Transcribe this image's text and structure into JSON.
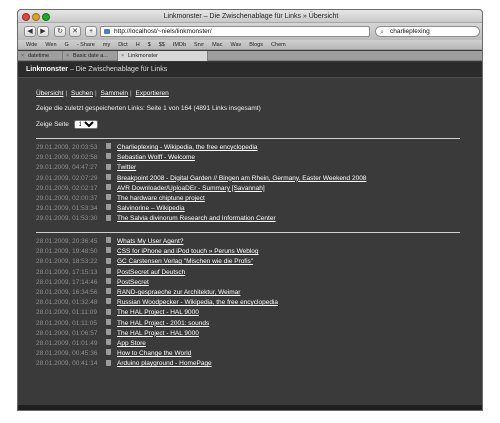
{
  "window": {
    "title": "Linkmonster – Die Zwischenablage für Links » Übersicht"
  },
  "toolbar": {
    "back": "◀",
    "forward": "▶",
    "reload": "↻",
    "stop": "✕",
    "add": "+",
    "url": "http://localhost/~niels/linkmonster/",
    "search_value": "charlieplexing"
  },
  "bookmarks": [
    "Wde",
    "Wen",
    "G",
    "- Share",
    "my",
    "Dict",
    "H",
    "$",
    "$$",
    "IMDb",
    "Srvr",
    "Mac",
    "Wav",
    "Blogs",
    "Chem"
  ],
  "tabs": [
    {
      "label": "datetime",
      "active": false
    },
    {
      "label": "Basic date a...",
      "active": false
    },
    {
      "label": "Linkmonster",
      "active": true
    }
  ],
  "header": {
    "brand": "Linkmonster",
    "tagline": " – Die Zwischenablage für Links"
  },
  "nav": {
    "items": [
      "Übersicht",
      "Suchen",
      "Sammeln",
      "Exportieren"
    ]
  },
  "info": "Zeige die zuletzt gespeicherten Links: Seite 1 von 164 (4891 Links insgesamt)",
  "page_select": {
    "label": "Zeige Seite",
    "value": "1"
  },
  "groups": [
    [
      {
        "ts": "29.01.2009, 20:03:53",
        "title": "Charlieplexing - Wikipedia, the free encyclopedia"
      },
      {
        "ts": "29.01.2009, 09:02:58",
        "title": "Sebastian Wolff - Welcome"
      },
      {
        "ts": "29.01.2009, 04:47:27",
        "title": "Twitter"
      },
      {
        "ts": "29.01.2009, 02:07:29",
        "title": "Breakpoint 2008 - Digital Garden // Bingen am Rhein, Germany, Easter Weekend 2008"
      },
      {
        "ts": "29.01.2009, 02:02:17",
        "title": "AVR Downloader/UploaDEr - Summary [Savannah]"
      },
      {
        "ts": "29.01.2009, 02:00:37",
        "title": "The hardware chiptune project"
      },
      {
        "ts": "29.01.2009, 01:53:34",
        "title": "Salvinorine – Wikipedia"
      },
      {
        "ts": "29.01.2009, 01:53:30",
        "title": "The Salvia divinorum Research and Information Center"
      }
    ],
    [
      {
        "ts": "28.01.2009, 20:36:45",
        "title": "Whats My User Agent?"
      },
      {
        "ts": "28.01.2009, 19:48:50",
        "title": "CSS for iPhone and iPod touch » Peruns Weblog"
      },
      {
        "ts": "28.01.2009, 18:53:22",
        "title": "GC Carstensen Verlag \"Mischen wie die Profis\""
      },
      {
        "ts": "28.01.2009, 17:15:13",
        "title": "PostSecret auf Deutsch"
      },
      {
        "ts": "28.01.2009, 17:14:46",
        "title": "PostSecret"
      },
      {
        "ts": "28.01.2009, 16:34:56",
        "title": "RAND-gespraeche zur Architektur, Weimar"
      },
      {
        "ts": "28.01.2009, 01:32:48",
        "title": "Russian Woodpecker - Wikipedia, the free encyclopedia"
      },
      {
        "ts": "28.01.2009, 01:11:09",
        "title": "The HAL Project - HAL 9000"
      },
      {
        "ts": "28.01.2009, 01:11:05",
        "title": "The HAL Project - 2001: sounds"
      },
      {
        "ts": "28.01.2009, 01:06:57",
        "title": "The HAL Project - HAL 9000"
      },
      {
        "ts": "28.01.2009, 01:01:49",
        "title": "App Store"
      },
      {
        "ts": "28.01.2009, 00:45:36",
        "title": "How to Change the World"
      },
      {
        "ts": "28.01.2009, 00:41:14",
        "title": "Arduino playground - HomePage"
      }
    ]
  ]
}
